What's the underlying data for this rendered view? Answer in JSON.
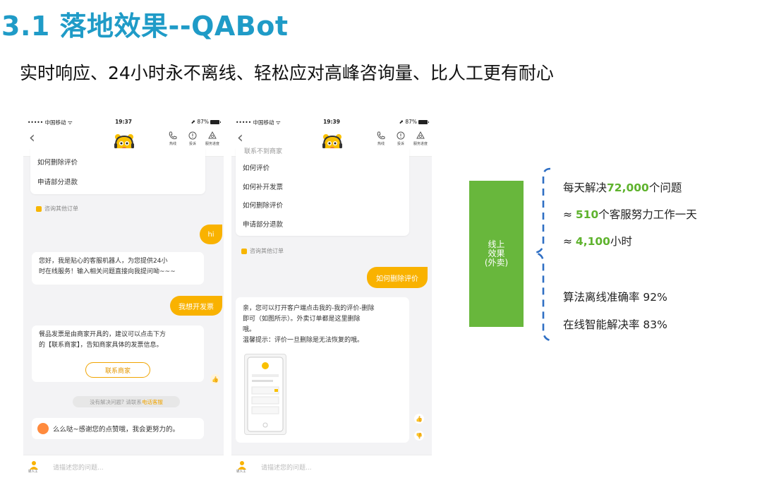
{
  "slide": {
    "title": "3.1 落地效果--QABot",
    "subtitle": "实时响应、24小时永不离线、轻松应对高峰咨询量、比人工更有耐心"
  },
  "phone1": {
    "status": {
      "carrier": "••••• 中国移动 ᯤ",
      "time": "19:37",
      "battery": "⬈ 87%"
    },
    "nav_actions": [
      "热线",
      "投诉",
      "服务进度"
    ],
    "menu_items": [
      "如何删除评价",
      "申请部分退款"
    ],
    "other_orders": "咨询其他订单",
    "user_msg_1": "hi",
    "bot_greeting": [
      "您好，我是贴心的客服机器人，为您提供24小",
      "时在线服务！输入相关问题直接向我提问呦~~~"
    ],
    "user_msg_2": "我想开发票",
    "bot_invoice": [
      "餐品发票是由商家开具的，建议可以点击下方",
      "的【联系商家】，告知商家具体的发票信息。"
    ],
    "contact_merchant": "联系商家",
    "feedback_prefix": "没有解决问题? 请联系",
    "feedback_link": "电话客服",
    "thanks": "么么哒~感谢您的点赞哦，我会更努力的。",
    "input_label": "转人工",
    "input_placeholder": "请描述您的问题..."
  },
  "phone2": {
    "status": {
      "carrier": "••••• 中国移动 ᯤ",
      "time": "19:39",
      "battery": "⬈ 87%"
    },
    "nav_actions": [
      "热线",
      "投诉",
      "服务进度"
    ],
    "cut_text": "联系不到商家",
    "menu_items": [
      "如何评价",
      "如何补开发票",
      "如何删除评价",
      "申请部分退款"
    ],
    "other_orders": "咨询其他订单",
    "user_msg": "如何删除评价",
    "bot_answer": [
      "亲，您可以打开客户端点击我的-我的评价-删除",
      "即可（如图所示）。外卖订单都是这里删除",
      "哦。",
      "温馨提示：评价一旦删除是无法恢复的哦。"
    ],
    "input_label": "转人工",
    "input_placeholder": "请描述您的问题..."
  },
  "effect_box": [
    "线上",
    "效果",
    "(外卖)"
  ],
  "stats": {
    "s1_pre": "每天解决",
    "s1_num": "72,000",
    "s1_post": "个问题",
    "s2_pre": "≈ ",
    "s2_num": "510",
    "s2_post": "个客服努力工作一天",
    "s3_pre": "≈ ",
    "s3_num": "4,100",
    "s3_post": "小时",
    "s4": "算法离线准确率 92%",
    "s5": "在线智能解决率 83%"
  },
  "colors": {
    "title": "#1f9bc7",
    "accent_green": "#68b73c",
    "brand_yellow": "#f9b200",
    "brace_blue": "#2f6fc4"
  }
}
